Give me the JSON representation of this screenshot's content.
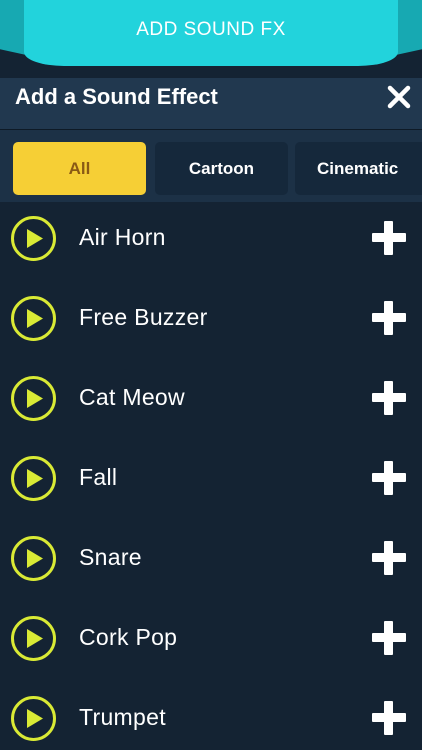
{
  "banner": {
    "title": "ADD SOUND FX"
  },
  "header": {
    "title": "Add a Sound Effect",
    "close_icon": "close-icon"
  },
  "tabs": [
    {
      "label": "All",
      "selected": true
    },
    {
      "label": "Cartoon",
      "selected": false
    },
    {
      "label": "Cinematic",
      "selected": false
    }
  ],
  "sounds": [
    {
      "name": "Air Horn"
    },
    {
      "name": "Free Buzzer"
    },
    {
      "name": "Cat Meow"
    },
    {
      "name": "Fall"
    },
    {
      "name": "Snare"
    },
    {
      "name": "Cork Pop"
    },
    {
      "name": "Trumpet"
    }
  ],
  "colors": {
    "background": "#142333",
    "banner": "#22d3dc",
    "selected_tab": "#f6cf35",
    "play_accent": "#d9ea35"
  }
}
